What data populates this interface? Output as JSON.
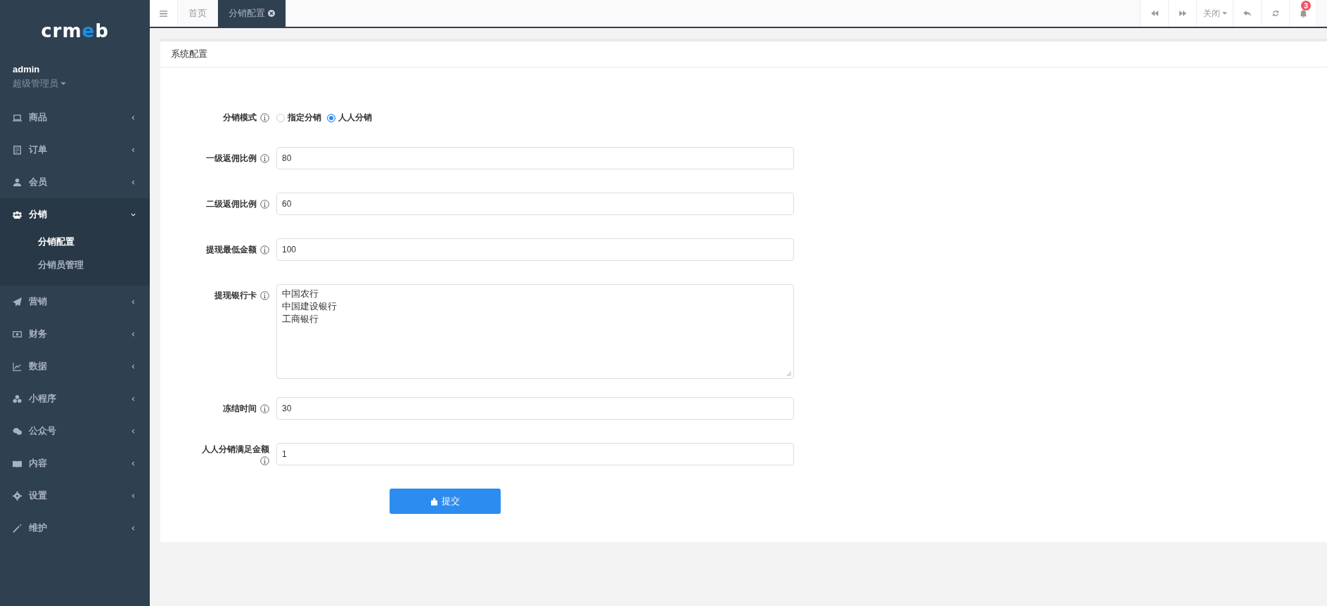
{
  "sidebar": {
    "logo": "crmeb",
    "user": {
      "name": "admin",
      "role": "超级管理员"
    },
    "menu": [
      {
        "label": "商品",
        "expanded": false
      },
      {
        "label": "订单",
        "expanded": false
      },
      {
        "label": "会员",
        "expanded": false
      },
      {
        "label": "分销",
        "expanded": true,
        "children": [
          {
            "label": "分销配置",
            "selected": true
          },
          {
            "label": "分销员管理",
            "selected": false
          }
        ]
      },
      {
        "label": "营销",
        "expanded": false
      },
      {
        "label": "财务",
        "expanded": false
      },
      {
        "label": "数据",
        "expanded": false
      },
      {
        "label": "小程序",
        "expanded": false
      },
      {
        "label": "公众号",
        "expanded": false
      },
      {
        "label": "内容",
        "expanded": false
      },
      {
        "label": "设置",
        "expanded": false
      },
      {
        "label": "维护",
        "expanded": false
      }
    ]
  },
  "tabs": [
    {
      "label": "首页",
      "selected": false
    },
    {
      "label": "分销配置",
      "selected": true
    }
  ],
  "toolbar": {
    "close_label": "关闭",
    "notification_count": "3"
  },
  "card": {
    "title": "系统配置",
    "fields": [
      {
        "kind": "radio",
        "label": "分销模式",
        "options": [
          {
            "label": "指定分销",
            "selected": false
          },
          {
            "label": "人人分销",
            "selected": true
          }
        ]
      },
      {
        "kind": "input",
        "label": "一级返佣比例",
        "value": "80"
      },
      {
        "kind": "input",
        "label": "二级返佣比例",
        "value": "60"
      },
      {
        "kind": "input",
        "label": "提现最低金额",
        "value": "100"
      },
      {
        "kind": "textarea",
        "label": "提现银行卡",
        "lines": [
          "中国农行",
          "中国建设银行",
          "工商银行"
        ]
      },
      {
        "kind": "input",
        "label": "冻结时间",
        "value": "30"
      },
      {
        "kind": "input",
        "label": "人人分销满足金额",
        "value": "1"
      }
    ],
    "submit": "提交"
  }
}
